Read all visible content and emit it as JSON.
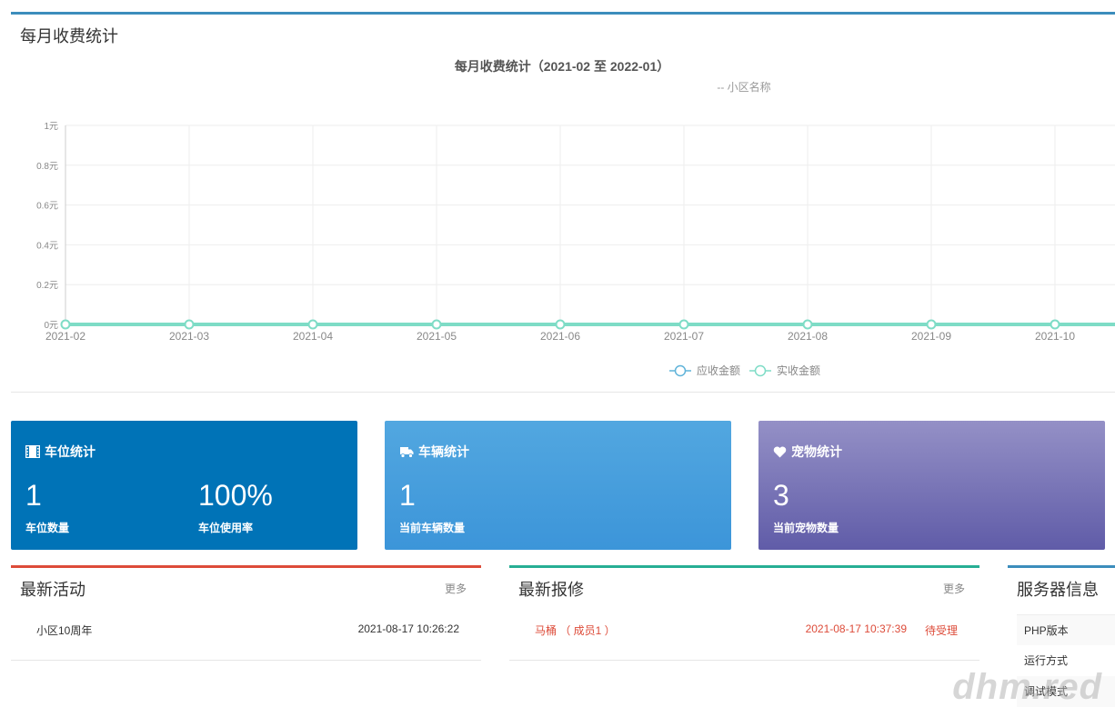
{
  "monthly_panel": {
    "title": "每月收费统计"
  },
  "chart_data": {
    "type": "line",
    "title": "每月收费统计（2021-02 至 2022-01）",
    "subtitle": "-- 小区名称",
    "categories": [
      "2021-02",
      "2021-03",
      "2021-04",
      "2021-05",
      "2021-06",
      "2021-07",
      "2021-08",
      "2021-09",
      "2021-10"
    ],
    "y_ticks": [
      "0元",
      "0.2元",
      "0.4元",
      "0.6元",
      "0.8元",
      "1元"
    ],
    "ylim": [
      0,
      1
    ],
    "grid": true,
    "legend_position": "bottom-center",
    "series": [
      {
        "name": "应收金额",
        "values": [
          0,
          0,
          0,
          0,
          0,
          0,
          0,
          0,
          0
        ],
        "color": "#5fb3d9"
      },
      {
        "name": "实收金额",
        "values": [
          0,
          0,
          0,
          0,
          0,
          0,
          0,
          0,
          0
        ],
        "color": "#7edcc6"
      }
    ]
  },
  "cards": {
    "parking": {
      "title": "车位统计",
      "icon": "film-icon",
      "count": "1",
      "count_label": "车位数量",
      "rate": "100%",
      "rate_label": "车位使用率",
      "color": "#0073b7"
    },
    "vehicles": {
      "title": "车辆统计",
      "icon": "truck-icon",
      "count": "1",
      "count_label": "当前车辆数量",
      "color": "#3c95d9"
    },
    "pets": {
      "title": "宠物统计",
      "icon": "heart-icon",
      "count": "3",
      "count_label": "当前宠物数量",
      "color": "#605ca8"
    }
  },
  "activities": {
    "title": "最新活动",
    "more": "更多",
    "items": [
      {
        "name": "小区10周年",
        "time": "2021-08-17 10:26:22"
      }
    ]
  },
  "repairs": {
    "title": "最新报修",
    "more": "更多",
    "items": [
      {
        "name": "马桶 （ 成员1 ）",
        "time": "2021-08-17 10:37:39",
        "status": "待受理"
      }
    ]
  },
  "server": {
    "title": "服务器信息",
    "rows": [
      "PHP版本",
      "运行方式",
      "调试模式"
    ]
  },
  "watermark": "dhm.red"
}
